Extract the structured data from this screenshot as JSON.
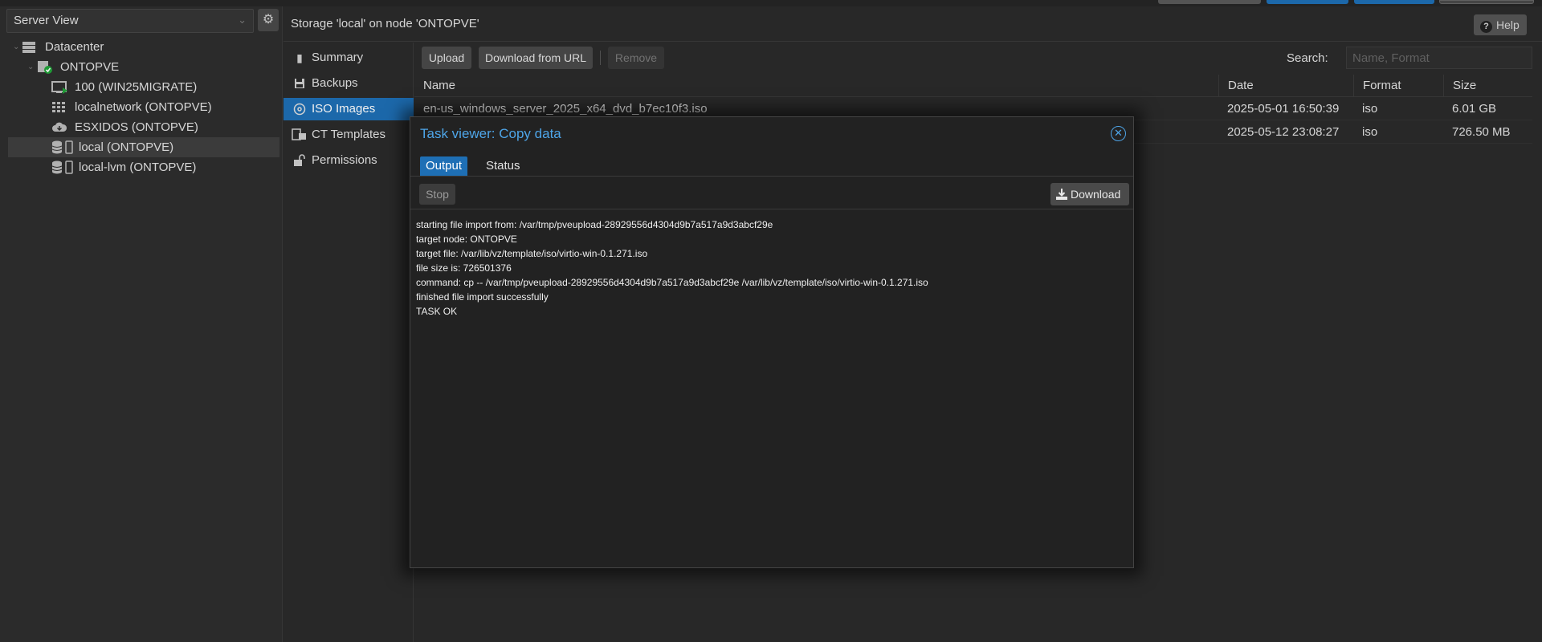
{
  "sidebar": {
    "view_selector": "Server View",
    "tree": [
      {
        "label": "Datacenter",
        "icon": "datacenter-icon"
      },
      {
        "label": "ONTOPVE",
        "icon": "node-online-icon"
      },
      {
        "label": "100 (WIN25MIGRATE)",
        "icon": "vm-icon"
      },
      {
        "label": "localnetwork (ONTOPVE)",
        "icon": "network-grid-icon"
      },
      {
        "label": "ESXIDOS (ONTOPVE)",
        "icon": "cloud-storage-icon"
      },
      {
        "label": "local (ONTOPVE)",
        "icon": "storage-icon"
      },
      {
        "label": "local-lvm (ONTOPVE)",
        "icon": "storage-icon"
      }
    ]
  },
  "panel": {
    "title": "Storage 'local' on node 'ONTOPVE'",
    "help_label": "Help"
  },
  "nav": [
    {
      "label": "Summary",
      "icon": "book-icon"
    },
    {
      "label": "Backups",
      "icon": "floppy-icon"
    },
    {
      "label": "ISO Images",
      "icon": "disc-icon"
    },
    {
      "label": "CT Templates",
      "icon": "template-icon"
    },
    {
      "label": "Permissions",
      "icon": "unlock-icon"
    }
  ],
  "toolbar": {
    "upload": "Upload",
    "download_url": "Download from URL",
    "remove": "Remove",
    "search_label": "Search:",
    "search_placeholder": "Name, Format"
  },
  "table": {
    "columns": [
      "Name",
      "Date",
      "Format",
      "Size"
    ],
    "rows": [
      {
        "name": "en-us_windows_server_2025_x64_dvd_b7ec10f3.iso",
        "date": "2025-05-01 16:50:39",
        "format": "iso",
        "size": "6.01 GB"
      },
      {
        "name": "",
        "date": "2025-05-12 23:08:27",
        "format": "iso",
        "size": "726.50 MB"
      }
    ]
  },
  "modal": {
    "title": "Task viewer: Copy data",
    "tabs": [
      "Output",
      "Status"
    ],
    "stop": "Stop",
    "download": "Download",
    "log": [
      "starting file import from: /var/tmp/pveupload-28929556d4304d9b7a517a9d3abcf29e",
      "target node: ONTOPVE",
      "target file: /var/lib/vz/template/iso/virtio-win-0.1.271.iso",
      "file size is: 726501376",
      "command: cp -- /var/tmp/pveupload-28929556d4304d9b7a517a9d3abcf29e /var/lib/vz/template/iso/virtio-win-0.1.271.iso",
      "finished file import successfully",
      "TASK OK"
    ]
  },
  "colors": {
    "accent": "#1e6fb5",
    "title_blue": "#4ea5e8",
    "background": "#2b2b2b"
  }
}
